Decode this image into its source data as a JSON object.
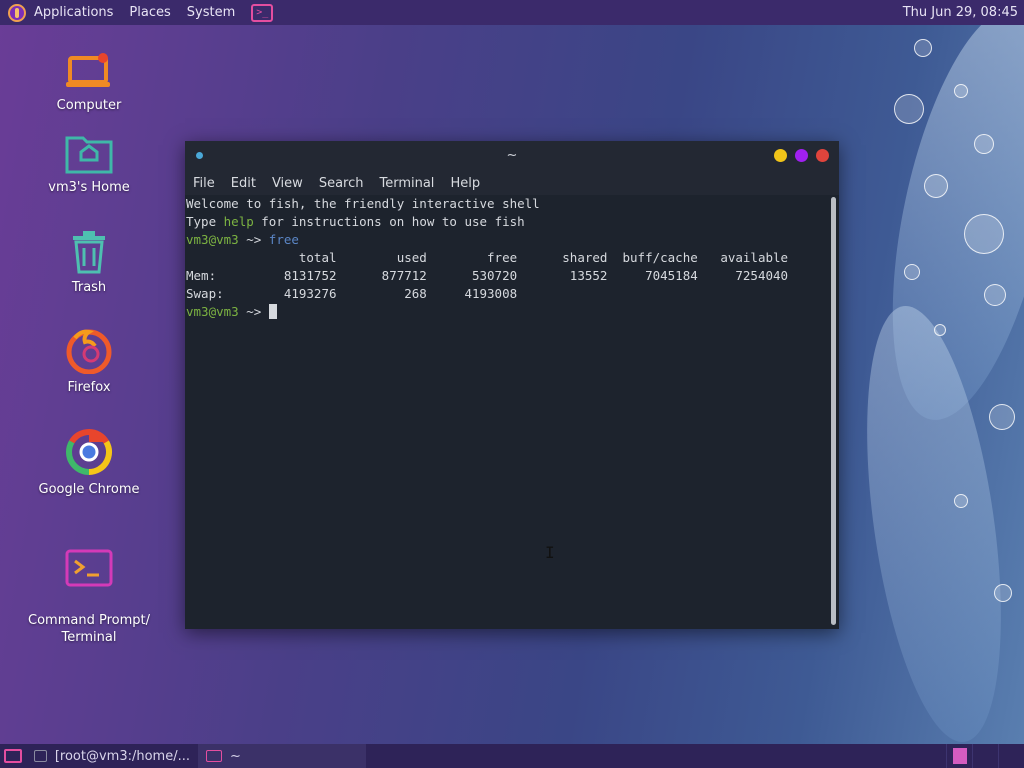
{
  "top_panel": {
    "menu": [
      "Applications",
      "Places",
      "System"
    ],
    "clock": "Thu Jun 29, 08:45"
  },
  "desktop_icons": [
    {
      "label": "Computer",
      "icon": "computer-icon"
    },
    {
      "label": "vm3's Home",
      "icon": "home-folder-icon"
    },
    {
      "label": "Trash",
      "icon": "trash-icon"
    },
    {
      "label": "Firefox",
      "icon": "firefox-icon"
    },
    {
      "label": "Google Chrome",
      "icon": "chrome-icon"
    },
    {
      "label": "Command Prompt/\nTerminal",
      "icon": "terminal-icon"
    }
  ],
  "terminal": {
    "title": "~",
    "menu": [
      "File",
      "Edit",
      "View",
      "Search",
      "Terminal",
      "Help"
    ],
    "welcome_1": "Welcome to fish, the friendly interactive shell",
    "welcome_2_pre": "Type ",
    "welcome_2_cmd": "help",
    "welcome_2_post": " for instructions on how to use fish",
    "prompt": "vm3@vm3",
    "prompt_arrow": " ~> ",
    "command": "free",
    "header": "               total        used        free      shared  buff/cache   available",
    "mem": "Mem:         8131752      877712      530720       13552     7045184     7254040",
    "swap": "Swap:        4193276         268     4193008"
  },
  "bottom_panel": {
    "tasks": [
      {
        "label": "[root@vm3:/home/...",
        "active": false
      },
      {
        "label": "~",
        "active": true
      }
    ]
  },
  "colors": {
    "close": "#e0443c",
    "maximize": "#a020f0",
    "minimize": "#f0c419",
    "accent": "#e44ea0"
  }
}
